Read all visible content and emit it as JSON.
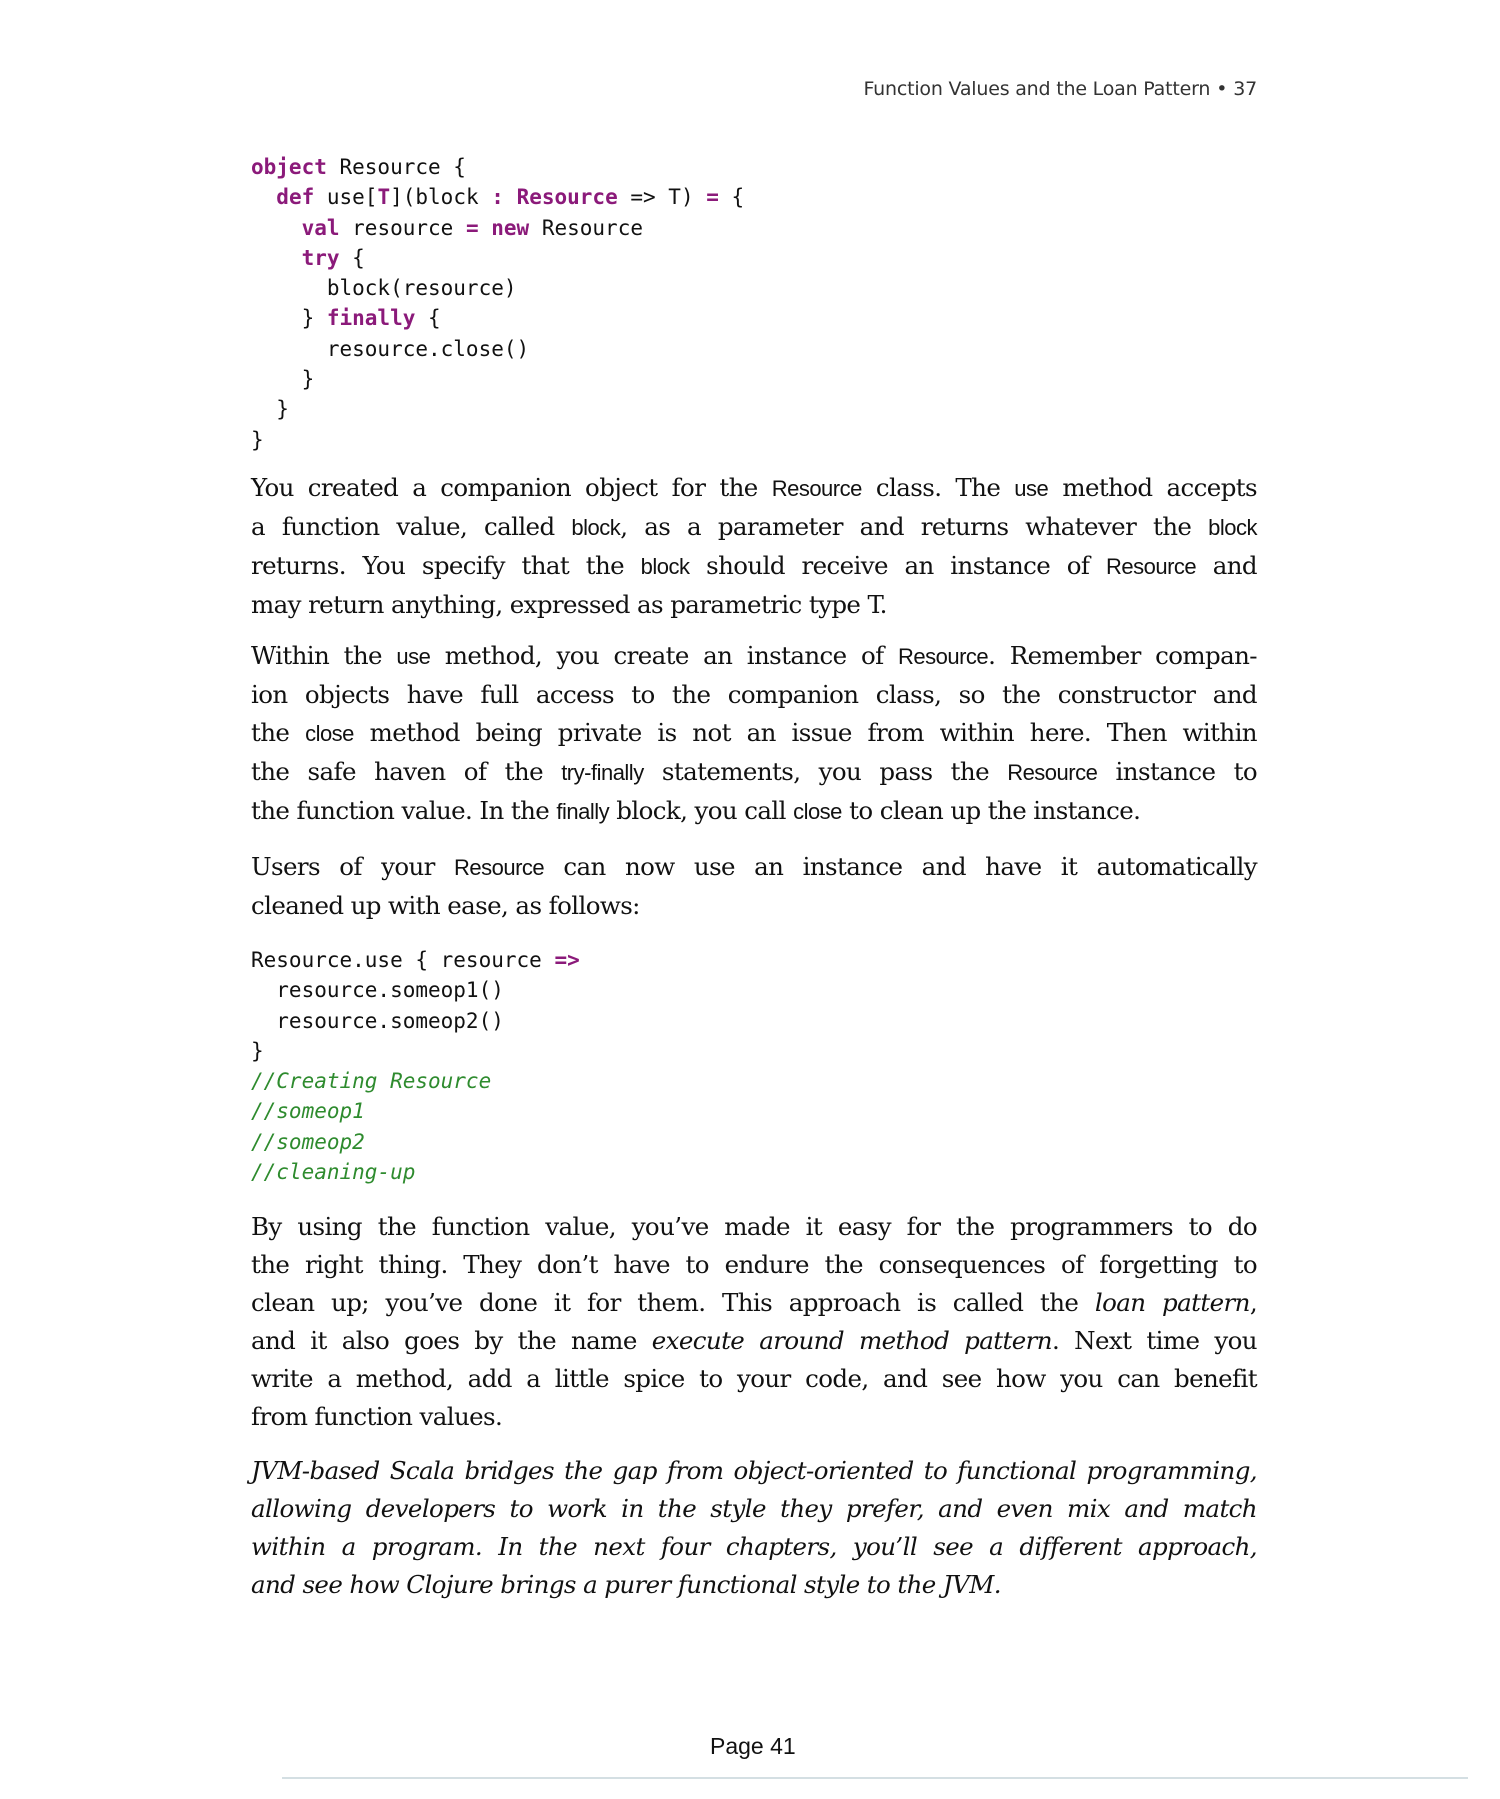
{
  "header": {
    "title": "Function Values and the Loan Pattern",
    "bullet": "•",
    "page": "37"
  },
  "code_block_1": {
    "lines": [
      [
        {
          "t": "object",
          "k": "kw"
        },
        {
          "t": " Resource {"
        }
      ],
      [
        {
          "t": "  "
        },
        {
          "t": "def",
          "k": "kw"
        },
        {
          "t": " use["
        },
        {
          "t": "T",
          "k": "kw"
        },
        {
          "t": "](block "
        },
        {
          "t": ":",
          "k": "kw"
        },
        {
          "t": " "
        },
        {
          "t": "Resource",
          "k": "kw"
        },
        {
          "t": " => T) "
        },
        {
          "t": "=",
          "k": "kw"
        },
        {
          "t": " {"
        }
      ],
      [
        {
          "t": "    "
        },
        {
          "t": "val",
          "k": "kw"
        },
        {
          "t": " resource "
        },
        {
          "t": "=",
          "k": "kw"
        },
        {
          "t": " "
        },
        {
          "t": "new",
          "k": "kw"
        },
        {
          "t": " Resource"
        }
      ],
      [
        {
          "t": "    "
        },
        {
          "t": "try",
          "k": "kw"
        },
        {
          "t": " {"
        }
      ],
      [
        {
          "t": "      block(resource)"
        }
      ],
      [
        {
          "t": "    } "
        },
        {
          "t": "finally",
          "k": "kw"
        },
        {
          "t": " {"
        }
      ],
      [
        {
          "t": "      resource.close()"
        }
      ],
      [
        {
          "t": "    }"
        }
      ],
      [
        {
          "t": "  }"
        }
      ],
      [
        {
          "t": "}"
        }
      ]
    ]
  },
  "paragraphs": [
    {
      "lines": [
        [
          {
            "t": "You created a companion object for the "
          },
          {
            "t": "Resource",
            "k": "ic"
          },
          {
            "t": " class. The "
          },
          {
            "t": "use",
            "k": "ic"
          },
          {
            "t": " method accepts"
          }
        ],
        [
          {
            "t": "a function value, called "
          },
          {
            "t": "block",
            "k": "ic"
          },
          {
            "t": ", as a parameter and returns whatever the "
          },
          {
            "t": "block",
            "k": "ic"
          }
        ],
        [
          {
            "t": "returns. You specify that the "
          },
          {
            "t": "block",
            "k": "ic"
          },
          {
            "t": " should receive an instance of "
          },
          {
            "t": "Resource",
            "k": "ic"
          },
          {
            "t": " and"
          }
        ],
        [
          {
            "t": "may return anything, expressed as parametric type T."
          }
        ]
      ]
    },
    {
      "lines": [
        [
          {
            "t": "Within the "
          },
          {
            "t": "use",
            "k": "ic"
          },
          {
            "t": " method, you create an instance of "
          },
          {
            "t": "Resource",
            "k": "ic"
          },
          {
            "t": ". Remember compan-"
          }
        ],
        [
          {
            "t": "ion objects have full access to the companion class, so the constructor and"
          }
        ],
        [
          {
            "t": "the "
          },
          {
            "t": "close",
            "k": "ic"
          },
          {
            "t": " method being private is not an issue from within here. Then within"
          }
        ],
        [
          {
            "t": "the safe haven of the "
          },
          {
            "t": "try-finally",
            "k": "ic"
          },
          {
            "t": " statements, you pass the "
          },
          {
            "t": "Resource",
            "k": "ic"
          },
          {
            "t": " instance to"
          }
        ],
        [
          {
            "t": "the function value. In the "
          },
          {
            "t": "finally",
            "k": "ic"
          },
          {
            "t": " block, you call "
          },
          {
            "t": "close",
            "k": "ic"
          },
          {
            "t": " to clean up the instance."
          }
        ]
      ]
    },
    {
      "lines": [
        [
          {
            "t": "Users of your "
          },
          {
            "t": "Resource",
            "k": "ic"
          },
          {
            "t": " can now use an instance and have it automatically"
          }
        ],
        [
          {
            "t": "cleaned up with ease, as follows:"
          }
        ]
      ]
    }
  ],
  "code_block_2": {
    "lines": [
      [
        {
          "t": "Resource.use { resource "
        },
        {
          "t": "=>",
          "k": "kw"
        }
      ],
      [
        {
          "t": "  resource.someop1()"
        }
      ],
      [
        {
          "t": "  resource.someop2()"
        }
      ],
      [
        {
          "t": "}"
        }
      ],
      [
        {
          "t": "//Creating Resource",
          "k": "cm"
        }
      ],
      [
        {
          "t": "//someop1",
          "k": "cm"
        }
      ],
      [
        {
          "t": "//someop2",
          "k": "cm"
        }
      ],
      [
        {
          "t": "//cleaning-up",
          "k": "cm"
        }
      ]
    ]
  },
  "paragraph_4": {
    "lines": [
      [
        {
          "t": "By using the function value, you’ve made it easy for the programmers to do"
        }
      ],
      [
        {
          "t": "the right thing. They don’t have to endure the consequences of forgetting to"
        }
      ],
      [
        {
          "t": "clean up; you’ve done it for them. This approach is called the "
        },
        {
          "t": "loan pattern",
          "k": "em"
        },
        {
          "t": ","
        }
      ],
      [
        {
          "t": "and it also goes by the name "
        },
        {
          "t": "execute around method pattern",
          "k": "em"
        },
        {
          "t": ". Next time you"
        }
      ],
      [
        {
          "t": "write a method, add a little spice to your code, and see how you can benefit"
        }
      ],
      [
        {
          "t": "from function values."
        }
      ]
    ]
  },
  "closing_italic": {
    "lines": [
      [
        {
          "t": "JVM-based Scala bridges the gap from object-oriented to functional programming,"
        }
      ],
      [
        {
          "t": "allowing developers to work in the style they prefer, and even mix and match"
        }
      ],
      [
        {
          "t": "within a program. In the next four chapters, you’ll see a different approach,"
        }
      ],
      [
        {
          "t": "and see how Clojure brings a purer functional style to the JVM."
        }
      ]
    ]
  },
  "footer": {
    "page_label": "Page 41"
  },
  "colors": {
    "keyword": "#8b1a7a",
    "comment": "#2e8b2e",
    "text": "#111111",
    "rule": "#d4dfe3"
  }
}
